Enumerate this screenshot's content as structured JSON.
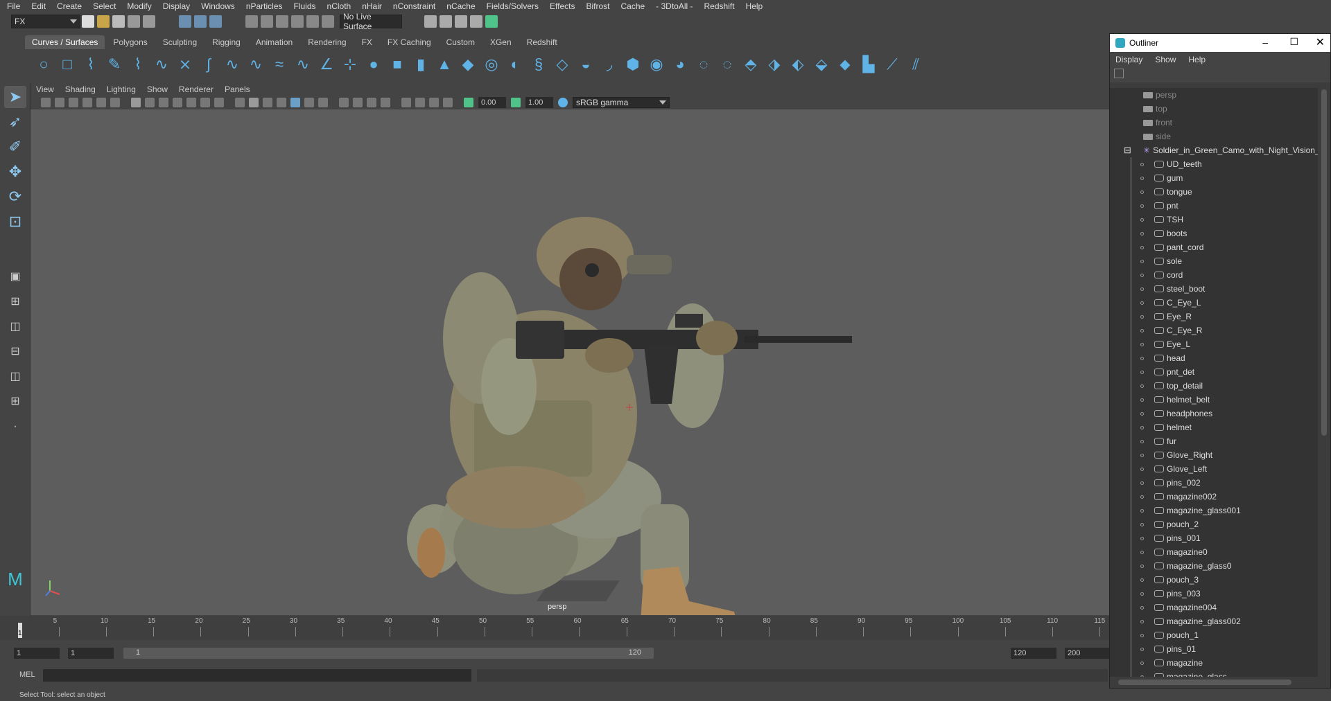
{
  "menubar": [
    "File",
    "Edit",
    "Create",
    "Select",
    "Modify",
    "Display",
    "Windows",
    "nParticles",
    "Fluids",
    "nCloth",
    "nHair",
    "nConstraint",
    "nCache",
    "Fields/Solvers",
    "Effects",
    "Bifrost",
    "Cache",
    "- 3DtoAll -",
    "Redshift",
    "Help"
  ],
  "status": {
    "mode": "FX",
    "live_surface": "No Live Surface"
  },
  "shelf_tabs": [
    "Curves / Surfaces",
    "Polygons",
    "Sculpting",
    "Rigging",
    "Animation",
    "Rendering",
    "FX",
    "FX Caching",
    "Custom",
    "XGen",
    "Redshift"
  ],
  "shelf_active": "Curves / Surfaces",
  "panel_menu": [
    "View",
    "Shading",
    "Lighting",
    "Show",
    "Renderer",
    "Panels"
  ],
  "panel_toolbar": {
    "exposure": "0.00",
    "gamma": "1.00",
    "color_space": "sRGB gamma"
  },
  "viewport": {
    "camera_label": "persp"
  },
  "timeline": {
    "ticks": [
      "1",
      "5",
      "10",
      "15",
      "20",
      "25",
      "30",
      "35",
      "40",
      "45",
      "50",
      "55",
      "60",
      "65",
      "70",
      "75",
      "80",
      "85",
      "90",
      "95",
      "100",
      "105",
      "110",
      "115"
    ],
    "current": "1"
  },
  "range": {
    "start": "1",
    "start2": "1",
    "slider_start": "1",
    "slider_end": "120",
    "end": "120",
    "end2": "200"
  },
  "command_line": {
    "label": "MEL"
  },
  "help_line": "Select Tool: select an object",
  "outliner": {
    "title": "Outliner",
    "menu": [
      "Display",
      "Show",
      "Help"
    ],
    "cameras": [
      "persp",
      "top",
      "front",
      "side"
    ],
    "group": "Soldier_in_Green_Camo_with_Night_Vision_Aimi",
    "children": [
      "UD_teeth",
      "gum",
      "tongue",
      "pnt",
      "TSH",
      "boots",
      "pant_cord",
      "sole",
      "cord",
      "steel_boot",
      "C_Eye_L",
      "Eye_R",
      "C_Eye_R",
      "Eye_L",
      "head",
      "pnt_det",
      "top_detail",
      "helmet_belt",
      "headphones",
      "helmet",
      "fur",
      "Glove_Right",
      "Glove_Left",
      "pins_002",
      "magazine002",
      "magazine_glass001",
      "pouch_2",
      "pins_001",
      "magazine0",
      "magazine_glass0",
      "pouch_3",
      "pins_003",
      "magazine004",
      "magazine_glass002",
      "pouch_1",
      "pins_01",
      "magazine",
      "magazine_glass"
    ]
  },
  "colors": {
    "accent": "#5fb3e6",
    "viewport_bg": "#5d5d5d",
    "panel_bg": "#444444"
  }
}
